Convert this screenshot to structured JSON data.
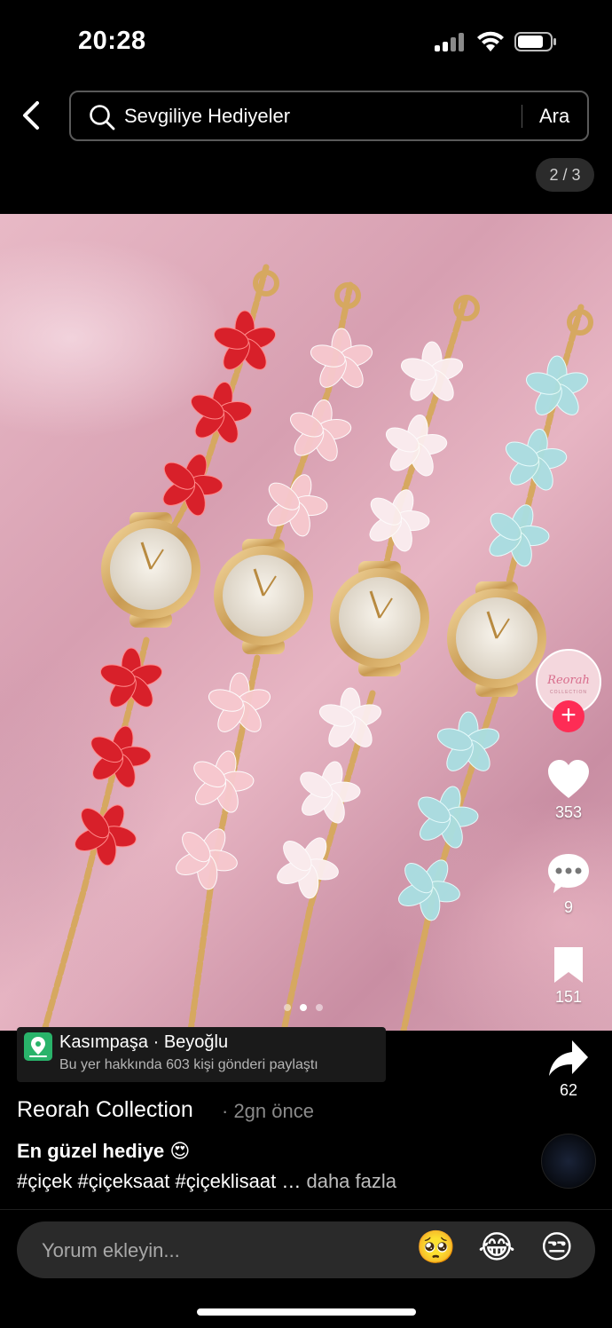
{
  "status_bar": {
    "time": "20:28"
  },
  "search": {
    "query": "Sevgiliye Hediyeler",
    "button": "Ara"
  },
  "photo": {
    "counter": "2 / 3",
    "description": "Four flower-link watches (red, pink, white, light blue) on pink satin"
  },
  "profile": {
    "avatar_text": "Reorah",
    "avatar_subtext": "COLLECTION",
    "follow_symbol": "+"
  },
  "actions": {
    "likes": "353",
    "comments": "9",
    "saves": "151",
    "shares": "62"
  },
  "location": {
    "title": "Kasımpaşa · Beyoğlu",
    "subtitle": "Bu yer hakkında 603 kişi gönderi paylaştı"
  },
  "post": {
    "author": "Reorah Collection",
    "time": "· 2gn önce",
    "caption": "En güzel hediye 😍",
    "hashtags": "#çiçek #çiçeksaat #çiçeklisaat …",
    "more": " daha fazla"
  },
  "comment": {
    "placeholder": "Yorum ekleyin...",
    "emojis": [
      "🥺",
      "😂",
      "😒"
    ]
  },
  "colors": {
    "accent": "#fe2c55",
    "location_icon": "#29b36a",
    "background": "#000000"
  }
}
